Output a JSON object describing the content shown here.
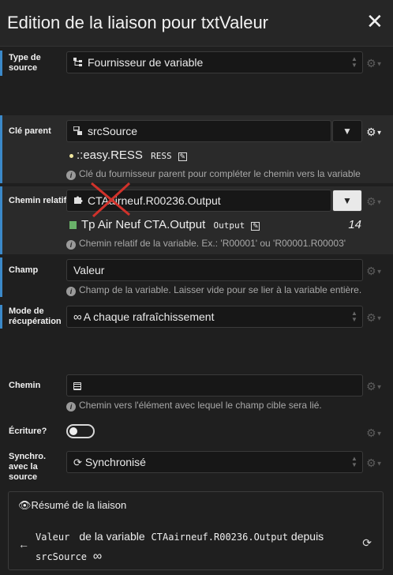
{
  "window": {
    "title": "Edition de la liaison pour txtValeur",
    "close_glyph": "✕"
  },
  "source_type": {
    "label": "Type de source",
    "value": "Fournisseur de variable"
  },
  "parent_key": {
    "label": "Clé parent",
    "value": "srcSource",
    "resolved_name": "easy.RESS",
    "resolved_tag": "RESS",
    "resolved_prefix": "::",
    "hint": "Clé du fournisseur parent pour compléter le chemin vers la variable"
  },
  "relative_path": {
    "label": "Chemin relatif",
    "value": "CTAairneuf.R00236.Output",
    "resolved_name": "Tp Air Neuf CTA.Output",
    "resolved_tag": "Output",
    "resolved_count": "14",
    "hint": "Chemin relatif de la variable. Ex.: 'R00001' ou 'R00001.R00003'"
  },
  "field": {
    "label": "Champ",
    "value": "Valeur",
    "hint": "Champ de la variable. Laisser vide pour se lier à la variable entière."
  },
  "retrieval_mode": {
    "label": "Mode de récupération",
    "value": "A chaque rafraîchissement"
  },
  "path": {
    "label": "Chemin",
    "value": "",
    "hint": "Chemin vers l'élément avec lequel le champ cible sera lié."
  },
  "write": {
    "label": "Écriture?",
    "enabled": false
  },
  "sync": {
    "label": "Synchro. avec la source",
    "value": "Synchronisé"
  },
  "summary": {
    "title": "Résumé de la liaison",
    "field_code": "Valeur",
    "text_of_variable": "de la variable",
    "variable_code": "CTAairneuf.R00236.Output",
    "text_from": "depuis",
    "source_code": "srcSource"
  },
  "colors": {
    "accent": "#3b89c9",
    "background": "#1f1f1f",
    "cross": "#d0322b"
  }
}
